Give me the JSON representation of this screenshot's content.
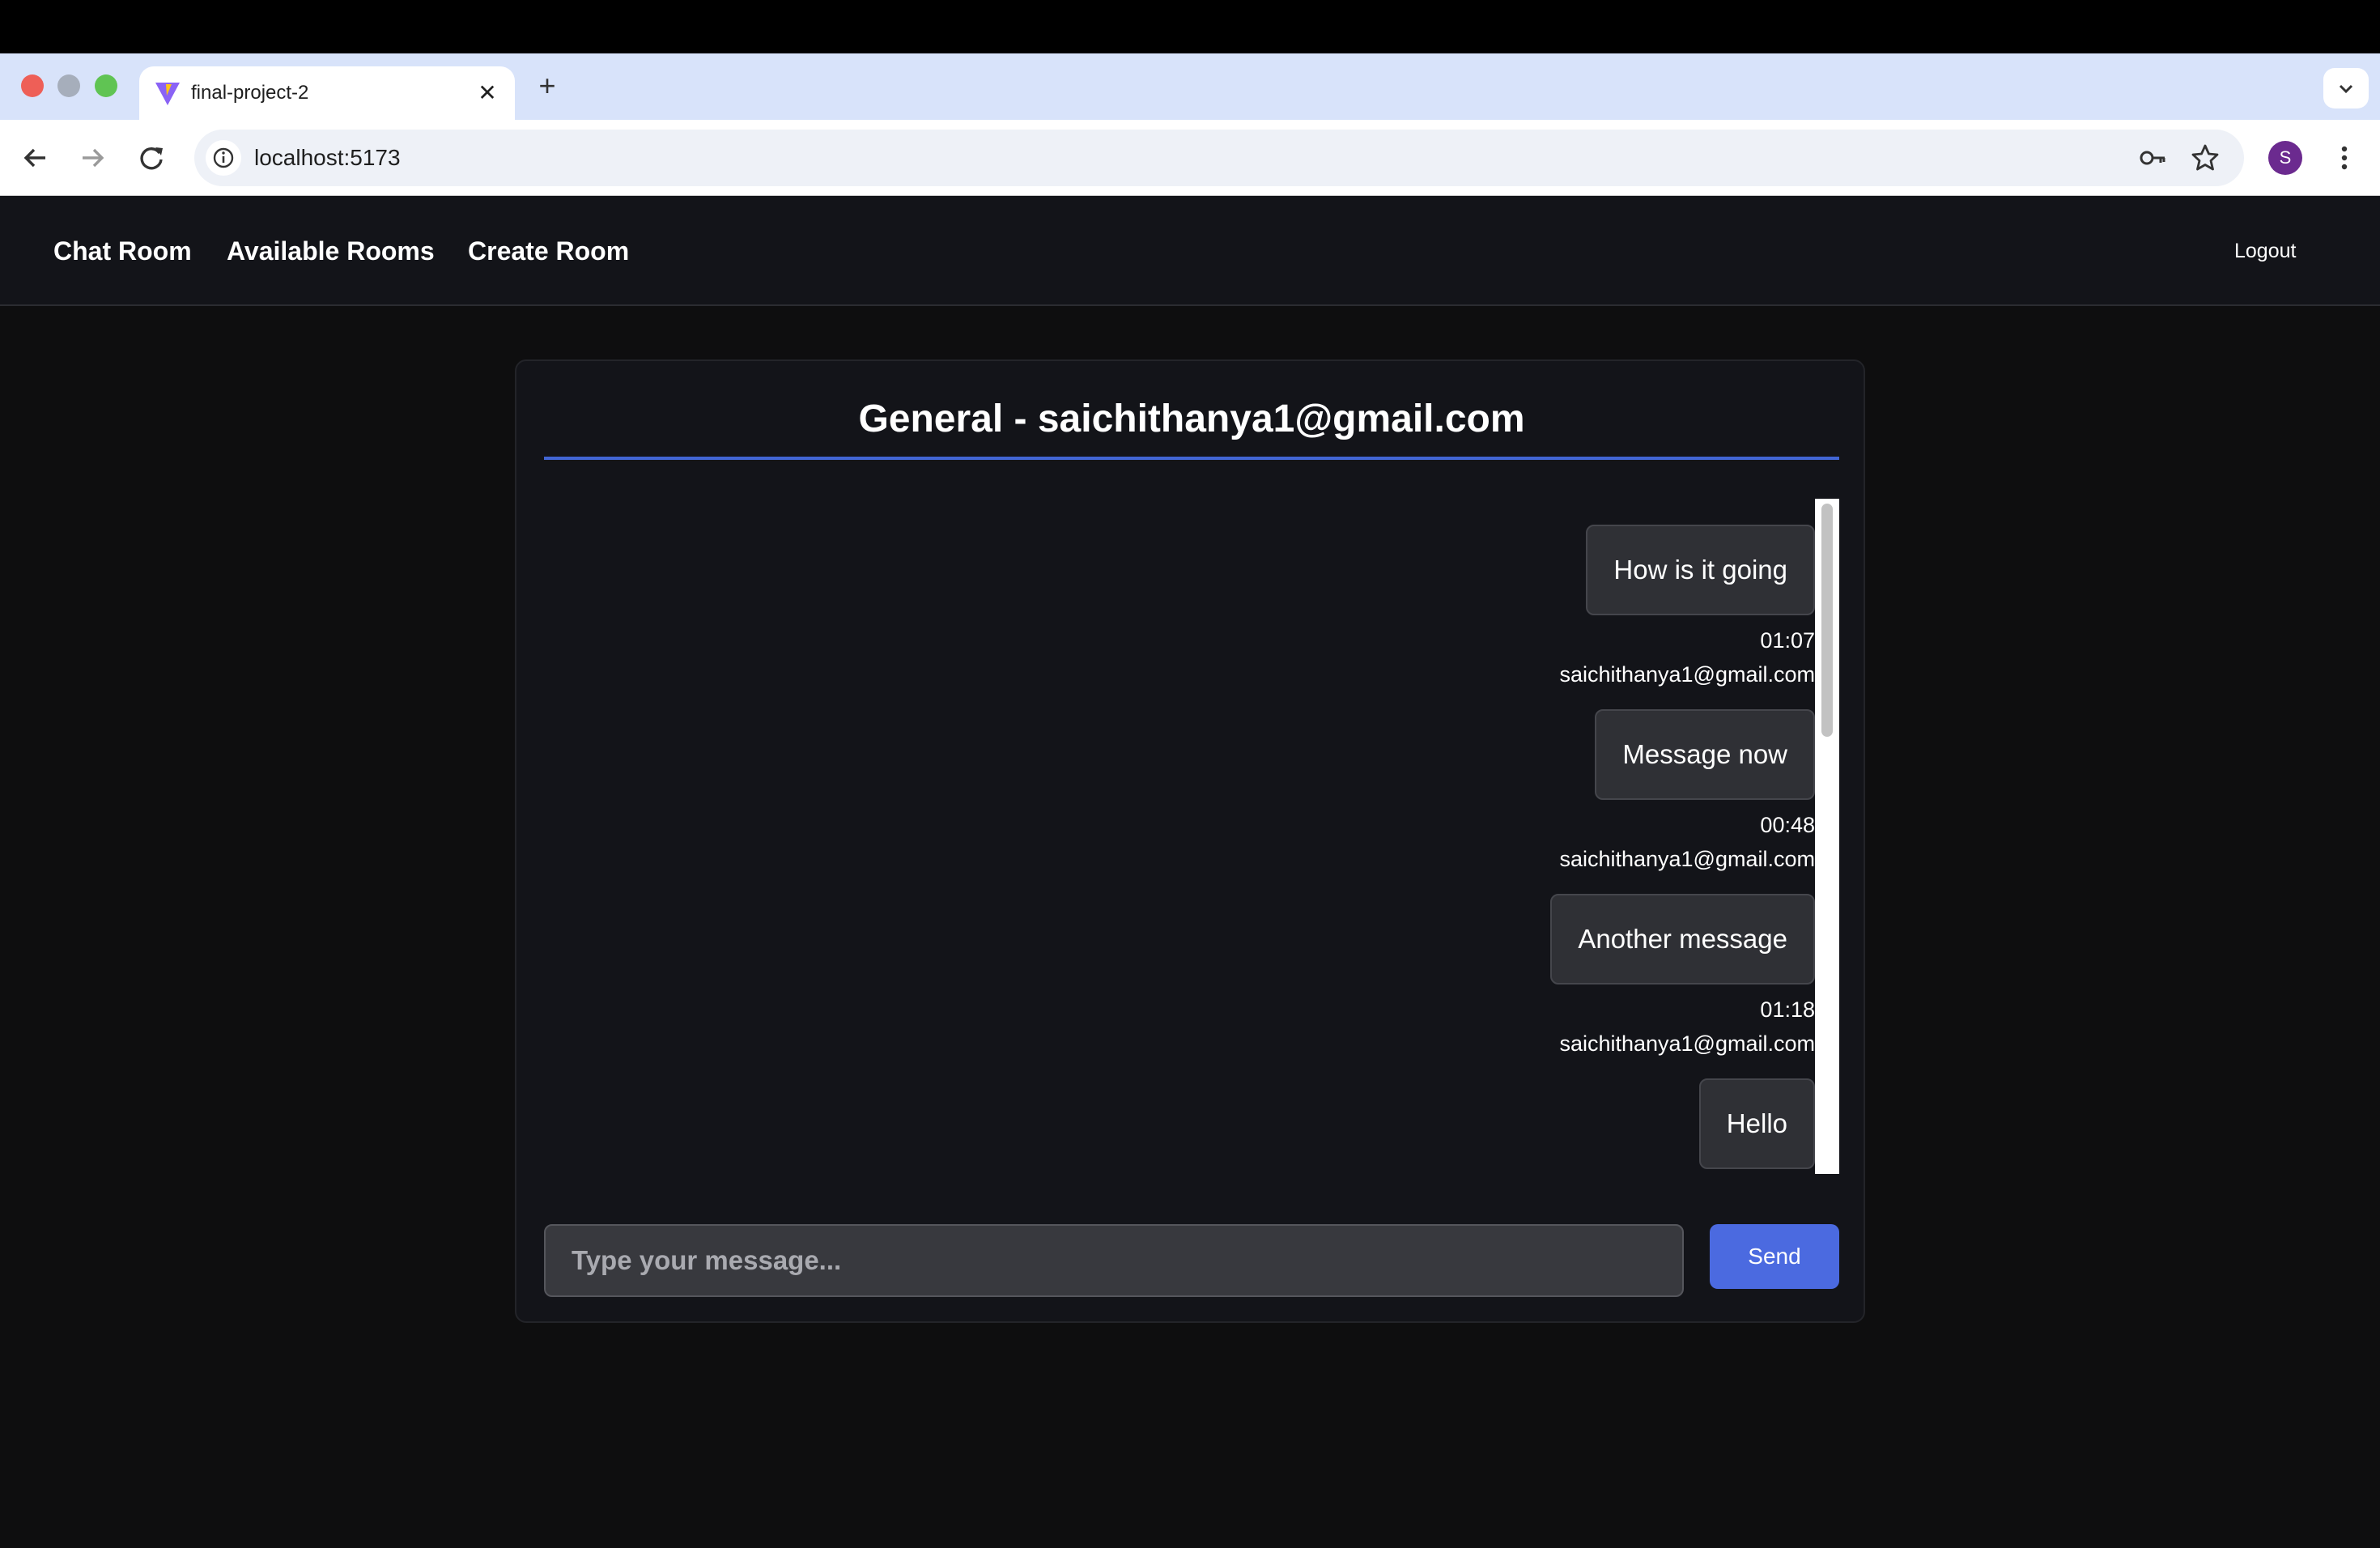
{
  "browser": {
    "tab_title": "final-project-2",
    "tab_close": "✕",
    "new_tab": "+",
    "url": "localhost:5173",
    "profile_initial": "S"
  },
  "nav": {
    "chat_room": "Chat Room",
    "available_rooms": "Available Rooms",
    "create_room": "Create Room",
    "logout": "Logout"
  },
  "chat": {
    "title": "General - saichithanya1@gmail.com",
    "messages": [
      {
        "text": "How is it going",
        "time": "01:07",
        "sender": "saichithanya1@gmail.com"
      },
      {
        "text": "Message now",
        "time": "00:48",
        "sender": "saichithanya1@gmail.com"
      },
      {
        "text": "Another message",
        "time": "01:18",
        "sender": "saichithanya1@gmail.com"
      },
      {
        "text": "Hello"
      }
    ],
    "input_placeholder": "Type your message...",
    "send_label": "Send"
  },
  "colors": {
    "accent": "#4b6ae0",
    "title_underline": "#4266d5",
    "page_bg": "#0e0e0f",
    "card_bg": "#131419"
  }
}
